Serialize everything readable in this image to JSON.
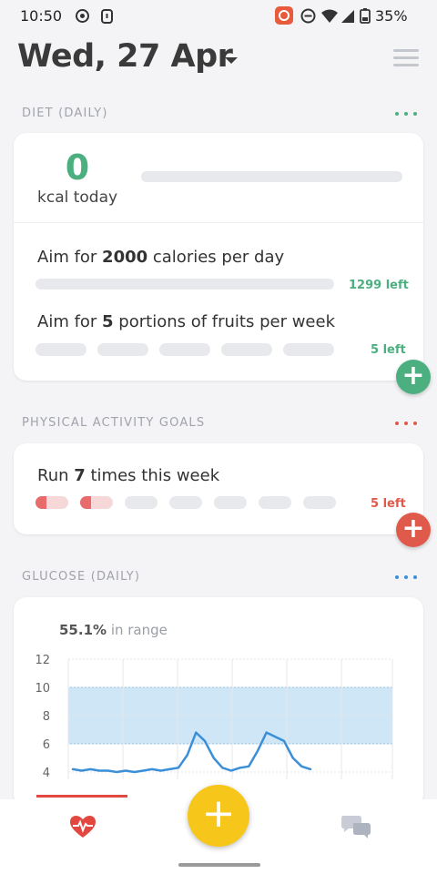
{
  "status_bar": {
    "time": "10:50",
    "battery": "35%"
  },
  "header": {
    "date": "Wed, 27 Apr"
  },
  "diet": {
    "section_title": "DIET (DAILY)",
    "kcal_value": "0",
    "kcal_label": "kcal today",
    "goal1": {
      "prefix": "Aim for ",
      "value": "2000",
      "suffix": " calories per day",
      "left": "1299 left"
    },
    "goal2": {
      "prefix": "Aim for ",
      "value": "5",
      "suffix": " portions of fruits per week",
      "left": "5 left"
    },
    "accent": "#4caf80"
  },
  "activity": {
    "section_title": "PHYSICAL ACTIVITY GOALS",
    "goal": {
      "prefix": "Run ",
      "value": "7",
      "suffix": " times this week",
      "left": "5 left"
    },
    "progress_done": 2,
    "progress_total": 7,
    "accent": "#e05a4b"
  },
  "glucose": {
    "section_title": "GLUCOSE (DAILY)",
    "in_range_value": "55.1%",
    "in_range_label": " in range",
    "accent": "#3a8fd8"
  },
  "chart_data": {
    "type": "line",
    "ylim": [
      3,
      12
    ],
    "y_ticks": [
      "12",
      "10",
      "8",
      "6",
      "4"
    ],
    "target_range": [
      6,
      10
    ],
    "series": [
      {
        "values": [
          4.2,
          4.1,
          4.2,
          4.1,
          4.1,
          4.0,
          4.1,
          4.0,
          4.1,
          4.2,
          4.1,
          4.2,
          4.3,
          5.2,
          6.8,
          6.2,
          5.0,
          4.3,
          4.1,
          4.3,
          4.4,
          5.5,
          6.8,
          6.5,
          6.2,
          5.0,
          4.4,
          4.2
        ]
      }
    ]
  },
  "icons": {
    "nav_left": "heart-monitor-icon",
    "nav_right": "chat-bubbles-icon",
    "fab": "plus-icon"
  }
}
